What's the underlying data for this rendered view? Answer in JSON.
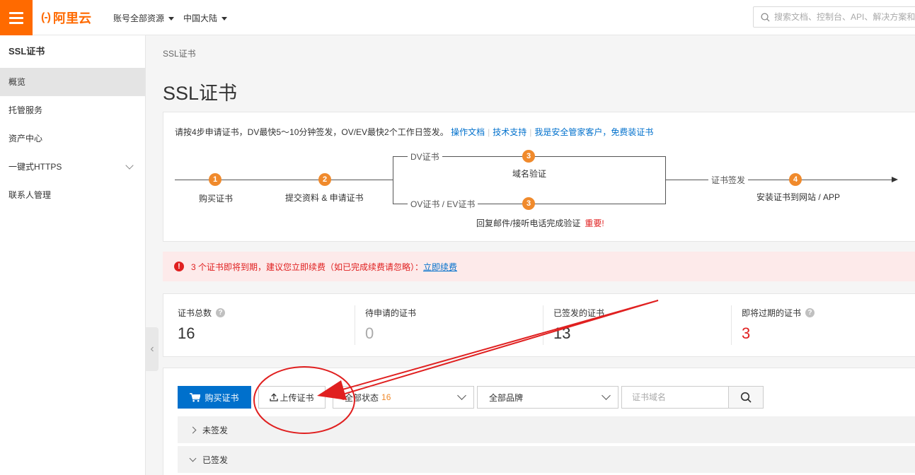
{
  "header": {
    "logo_mark": "(-)",
    "logo_text": "阿里云",
    "account_dropdown": "账号全部资源",
    "region_dropdown": "中国大陆",
    "search_placeholder": "搜索文档、控制台、API、解决方案和"
  },
  "sidebar": {
    "title": "SSL证书",
    "items": [
      {
        "label": "概览",
        "active": true
      },
      {
        "label": "托管服务"
      },
      {
        "label": "资产中心"
      },
      {
        "label": "一键式HTTPS",
        "expandable": true
      },
      {
        "label": "联系人管理"
      }
    ]
  },
  "main": {
    "breadcrumb": "SSL证书",
    "title": "SSL证书",
    "steps": {
      "intro": "请按4步申请证书，DV最快5～10分钟签发，OV/EV最快2个工作日签发。",
      "links": [
        "操作文档",
        "技术支持",
        "我是安全管家客户，免费装证书"
      ],
      "step1": {
        "num": "1",
        "label": "购买证书"
      },
      "step2": {
        "num": "2",
        "label": "提交资料 & 申请证书"
      },
      "step3_dv": {
        "num": "3",
        "line_label": "DV证书",
        "label": "域名验证"
      },
      "step3_ov": {
        "num": "3",
        "line_label": "OV证书 / EV证书",
        "label": "回复邮件/接听电话完成验证",
        "important": "重要!"
      },
      "issue_label": "证书签发",
      "step4": {
        "num": "4",
        "label": "安装证书到网站 / APP"
      }
    },
    "alert": {
      "icon": "!",
      "text": "3 个证书即将到期，建议您立即续费（如已完成续费请忽略）：",
      "link": "立即续费"
    },
    "stats": [
      {
        "label": "证书总数",
        "value": "16",
        "help": true
      },
      {
        "label": "待申请的证书",
        "value": "0"
      },
      {
        "label": "已签发的证书",
        "value": "13"
      },
      {
        "label": "即将过期的证书",
        "value": "3",
        "help": true
      }
    ],
    "toolbar": {
      "buy_label": "购买证书",
      "upload_label": "上传证书",
      "status_select": "全部状态",
      "status_count": "16",
      "brand_select": "全部品牌",
      "domain_placeholder": "证书域名"
    },
    "groups": [
      {
        "label": "未签发",
        "expanded": false
      },
      {
        "label": "已签发",
        "expanded": true
      }
    ]
  },
  "colors": {
    "brand_orange": "#ff6a00",
    "primary_blue": "#0070cc",
    "step_orange": "#f08a2c",
    "alert_red": "#e02020",
    "annotation_red": "#e02020"
  }
}
